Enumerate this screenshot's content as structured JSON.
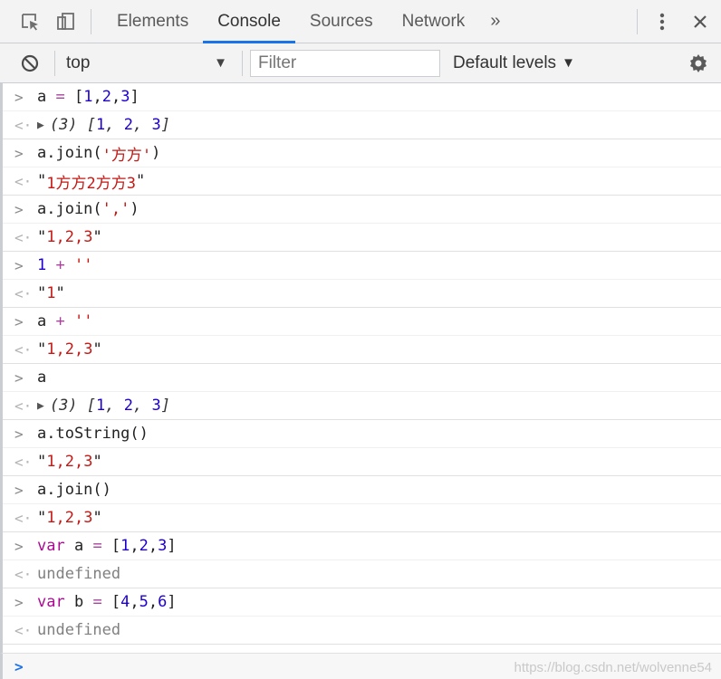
{
  "tabs": {
    "items": [
      "Elements",
      "Console",
      "Sources",
      "Network"
    ],
    "more": "»"
  },
  "toolbar": {
    "context": "top",
    "filter_placeholder": "Filter",
    "levels": "Default levels",
    "levels_arrow": "▼",
    "context_arrow": "▼"
  },
  "console": {
    "rows": [
      {
        "kind": "in",
        "parts": [
          {
            "t": "a ",
            "c": "plain"
          },
          {
            "t": "=",
            "c": "op"
          },
          {
            "t": " [",
            "c": "plain"
          },
          {
            "t": "1",
            "c": "num"
          },
          {
            "t": ",",
            "c": "plain"
          },
          {
            "t": "2",
            "c": "num"
          },
          {
            "t": ",",
            "c": "plain"
          },
          {
            "t": "3",
            "c": "num"
          },
          {
            "t": "]",
            "c": "plain"
          }
        ]
      },
      {
        "kind": "out",
        "parts": [
          {
            "t": "▶",
            "c": "tri"
          },
          {
            "t": "(3) [",
            "c": "ital"
          },
          {
            "t": "1",
            "c": "num"
          },
          {
            "t": ", ",
            "c": "ital"
          },
          {
            "t": "2",
            "c": "num"
          },
          {
            "t": ", ",
            "c": "ital"
          },
          {
            "t": "3",
            "c": "num"
          },
          {
            "t": "]",
            "c": "ital"
          }
        ]
      },
      {
        "kind": "in",
        "parts": [
          {
            "t": "a.join(",
            "c": "plain"
          },
          {
            "t": "'方方'",
            "c": "str"
          },
          {
            "t": ")",
            "c": "plain"
          }
        ]
      },
      {
        "kind": "out",
        "parts": [
          {
            "t": "\"",
            "c": "plain"
          },
          {
            "t": "1方方2方方3",
            "c": "str"
          },
          {
            "t": "\"",
            "c": "plain"
          }
        ]
      },
      {
        "kind": "in",
        "parts": [
          {
            "t": "a.join(",
            "c": "plain"
          },
          {
            "t": "','",
            "c": "str"
          },
          {
            "t": ")",
            "c": "plain"
          }
        ]
      },
      {
        "kind": "out",
        "parts": [
          {
            "t": "\"",
            "c": "plain"
          },
          {
            "t": "1,2,3",
            "c": "str"
          },
          {
            "t": "\"",
            "c": "plain"
          }
        ]
      },
      {
        "kind": "in",
        "parts": [
          {
            "t": "1",
            "c": "num"
          },
          {
            "t": " + ",
            "c": "op"
          },
          {
            "t": "''",
            "c": "str"
          }
        ]
      },
      {
        "kind": "out",
        "parts": [
          {
            "t": "\"",
            "c": "plain"
          },
          {
            "t": "1",
            "c": "str"
          },
          {
            "t": "\"",
            "c": "plain"
          }
        ]
      },
      {
        "kind": "in",
        "parts": [
          {
            "t": "a ",
            "c": "plain"
          },
          {
            "t": "+",
            "c": "op"
          },
          {
            "t": " ",
            "c": "plain"
          },
          {
            "t": "''",
            "c": "str"
          }
        ]
      },
      {
        "kind": "out",
        "parts": [
          {
            "t": "\"",
            "c": "plain"
          },
          {
            "t": "1,2,3",
            "c": "str"
          },
          {
            "t": "\"",
            "c": "plain"
          }
        ]
      },
      {
        "kind": "in",
        "parts": [
          {
            "t": "a",
            "c": "plain"
          }
        ]
      },
      {
        "kind": "out",
        "parts": [
          {
            "t": "▶",
            "c": "tri"
          },
          {
            "t": "(3) [",
            "c": "ital"
          },
          {
            "t": "1",
            "c": "num"
          },
          {
            "t": ", ",
            "c": "ital"
          },
          {
            "t": "2",
            "c": "num"
          },
          {
            "t": ", ",
            "c": "ital"
          },
          {
            "t": "3",
            "c": "num"
          },
          {
            "t": "]",
            "c": "ital"
          }
        ]
      },
      {
        "kind": "in",
        "parts": [
          {
            "t": "a.toString()",
            "c": "plain"
          }
        ]
      },
      {
        "kind": "out",
        "parts": [
          {
            "t": "\"",
            "c": "plain"
          },
          {
            "t": "1,2,3",
            "c": "str"
          },
          {
            "t": "\"",
            "c": "plain"
          }
        ]
      },
      {
        "kind": "in",
        "parts": [
          {
            "t": "a.join()",
            "c": "plain"
          }
        ]
      },
      {
        "kind": "out",
        "parts": [
          {
            "t": "\"",
            "c": "plain"
          },
          {
            "t": "1,2,3",
            "c": "str"
          },
          {
            "t": "\"",
            "c": "plain"
          }
        ]
      },
      {
        "kind": "in",
        "parts": [
          {
            "t": "var",
            "c": "kw"
          },
          {
            "t": " a ",
            "c": "plain"
          },
          {
            "t": "=",
            "c": "op"
          },
          {
            "t": " [",
            "c": "plain"
          },
          {
            "t": "1",
            "c": "num"
          },
          {
            "t": ",",
            "c": "plain"
          },
          {
            "t": "2",
            "c": "num"
          },
          {
            "t": ",",
            "c": "plain"
          },
          {
            "t": "3",
            "c": "num"
          },
          {
            "t": "]",
            "c": "plain"
          }
        ]
      },
      {
        "kind": "out",
        "parts": [
          {
            "t": "undefined",
            "c": "gray"
          }
        ]
      },
      {
        "kind": "in",
        "parts": [
          {
            "t": "var",
            "c": "kw"
          },
          {
            "t": " b ",
            "c": "plain"
          },
          {
            "t": "=",
            "c": "op"
          },
          {
            "t": " [",
            "c": "plain"
          },
          {
            "t": "4",
            "c": "num"
          },
          {
            "t": ",",
            "c": "plain"
          },
          {
            "t": "5",
            "c": "num"
          },
          {
            "t": ",",
            "c": "plain"
          },
          {
            "t": "6",
            "c": "num"
          },
          {
            "t": "]",
            "c": "plain"
          }
        ]
      },
      {
        "kind": "out",
        "parts": [
          {
            "t": "undefined",
            "c": "gray"
          }
        ]
      }
    ],
    "in_prefix": ">",
    "out_prefix": "<·"
  },
  "prompt": {
    "caret": ">"
  },
  "watermark": "https://blog.csdn.net/wolvenne54",
  "colors": {
    "accent": "#1a73e8",
    "string": "#c41a16",
    "number": "#1c00cf",
    "keyword": "#aa0d91"
  }
}
